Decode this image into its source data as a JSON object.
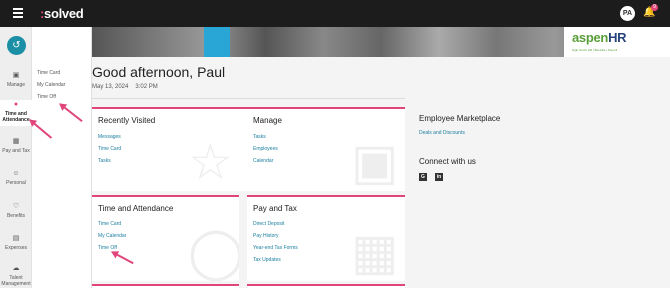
{
  "topbar": {
    "logo_text": "solved",
    "logo_prefix": ":",
    "avatar_initials": "PA",
    "notification_count": "9"
  },
  "rail": {
    "items": [
      {
        "label": "Manage",
        "icon": "briefcase-icon"
      },
      {
        "label": "Time and Attendance",
        "icon": "clock-icon"
      },
      {
        "label": "Pay and Tax",
        "icon": "money-icon"
      },
      {
        "label": "Personal",
        "icon": "person-icon"
      },
      {
        "label": "Benefits",
        "icon": "heart-icon"
      },
      {
        "label": "Expenses",
        "icon": "receipt-icon"
      },
      {
        "label": "Talent Management",
        "icon": "cloud-icon"
      }
    ]
  },
  "flyout": {
    "items": [
      "Time Card",
      "My Calendar",
      "Time Off"
    ]
  },
  "banner": {
    "brand": "aspen",
    "brand_hr": "HR",
    "tagline": "High Touch HR | Benefits | Payroll"
  },
  "main": {
    "greeting": "Good afternoon, Paul",
    "date": "May 13, 2024",
    "time": "3:02 PM"
  },
  "cards": {
    "recent": {
      "title": "Recently Visited",
      "links": [
        "Messages",
        "Time Card",
        "Tasks"
      ]
    },
    "manage": {
      "title": "Manage",
      "links": [
        "Tasks",
        "Employees",
        "Calendar"
      ]
    },
    "time": {
      "title": "Time and Attendance",
      "links": [
        "Time Card",
        "My Calendar",
        "Time Off"
      ]
    },
    "pay": {
      "title": "Pay and Tax",
      "links": [
        "Direct Deposit",
        "Pay History",
        "Year-end Tax Forms",
        "Tax Updates"
      ]
    }
  },
  "right": {
    "marketplace_title": "Employee Marketplace",
    "marketplace_link": "Deals and Discounts",
    "connect_title": "Connect with us",
    "social": [
      "G",
      "in"
    ]
  },
  "colors": {
    "accent": "#e0457b",
    "link": "#1b7fa0",
    "brand_teal": "#1b8fa6"
  }
}
